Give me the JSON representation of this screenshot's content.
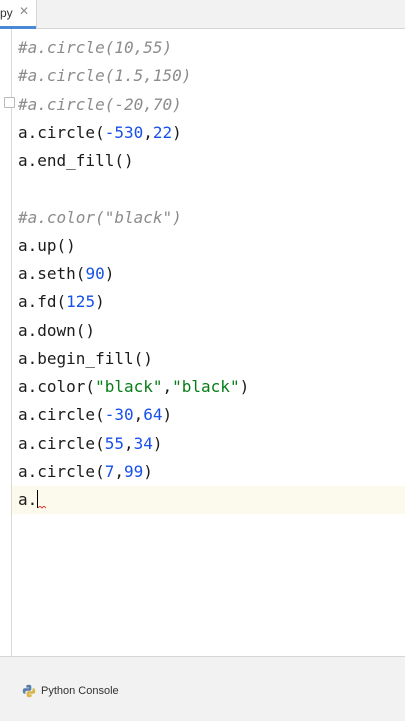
{
  "tab": {
    "label": "py",
    "close_glyph": "✕"
  },
  "editor": {
    "lines": [
      {
        "parts": [
          {
            "t": "#a.circle(10,55)",
            "c": "comment"
          }
        ]
      },
      {
        "parts": [
          {
            "t": "#a.circle(1.5,150)",
            "c": "comment"
          }
        ]
      },
      {
        "parts": [
          {
            "t": "#a.circle(-20,70)",
            "c": "comment"
          }
        ]
      },
      {
        "parts": [
          {
            "t": "a.circle(",
            "c": ""
          },
          {
            "t": "-530",
            "c": "num"
          },
          {
            "t": ",",
            "c": ""
          },
          {
            "t": "22",
            "c": "num"
          },
          {
            "t": ")",
            "c": ""
          }
        ]
      },
      {
        "parts": [
          {
            "t": "a.end_fill()",
            "c": ""
          }
        ]
      },
      {
        "parts": []
      },
      {
        "parts": [
          {
            "t": "#a.color(\"black\")",
            "c": "comment"
          }
        ]
      },
      {
        "parts": [
          {
            "t": "a.up()",
            "c": ""
          }
        ]
      },
      {
        "parts": [
          {
            "t": "a.seth(",
            "c": ""
          },
          {
            "t": "90",
            "c": "num"
          },
          {
            "t": ")",
            "c": ""
          }
        ]
      },
      {
        "parts": [
          {
            "t": "a.fd(",
            "c": ""
          },
          {
            "t": "125",
            "c": "num"
          },
          {
            "t": ")",
            "c": ""
          }
        ]
      },
      {
        "parts": [
          {
            "t": "a.down()",
            "c": ""
          }
        ]
      },
      {
        "parts": [
          {
            "t": "a.begin_fill()",
            "c": ""
          }
        ]
      },
      {
        "parts": [
          {
            "t": "a.color(",
            "c": ""
          },
          {
            "t": "\"black\"",
            "c": "str"
          },
          {
            "t": ",",
            "c": ""
          },
          {
            "t": "\"black\"",
            "c": "str"
          },
          {
            "t": ")",
            "c": ""
          }
        ]
      },
      {
        "parts": [
          {
            "t": "a.circle(",
            "c": ""
          },
          {
            "t": "-30",
            "c": "num"
          },
          {
            "t": ",",
            "c": ""
          },
          {
            "t": "64",
            "c": "num"
          },
          {
            "t": ")",
            "c": ""
          }
        ]
      },
      {
        "parts": [
          {
            "t": "a.circle(",
            "c": ""
          },
          {
            "t": "55",
            "c": "num"
          },
          {
            "t": ",",
            "c": ""
          },
          {
            "t": "34",
            "c": "num"
          },
          {
            "t": ")",
            "c": ""
          }
        ]
      },
      {
        "parts": [
          {
            "t": "a.circle(",
            "c": ""
          },
          {
            "t": "7",
            "c": "num"
          },
          {
            "t": ",",
            "c": ""
          },
          {
            "t": "99",
            "c": "num"
          },
          {
            "t": ")",
            "c": ""
          }
        ]
      },
      {
        "parts": [
          {
            "t": "a.",
            "c": ""
          }
        ],
        "cursor": true
      }
    ]
  },
  "bottom_bar": {
    "python_console_label": "Python Console",
    "python_console_icon": "python-icon"
  },
  "colors": {
    "comment": "#8c8c8c",
    "number": "#1750eb",
    "string": "#067d17",
    "tab_accent": "#4a87d6"
  }
}
